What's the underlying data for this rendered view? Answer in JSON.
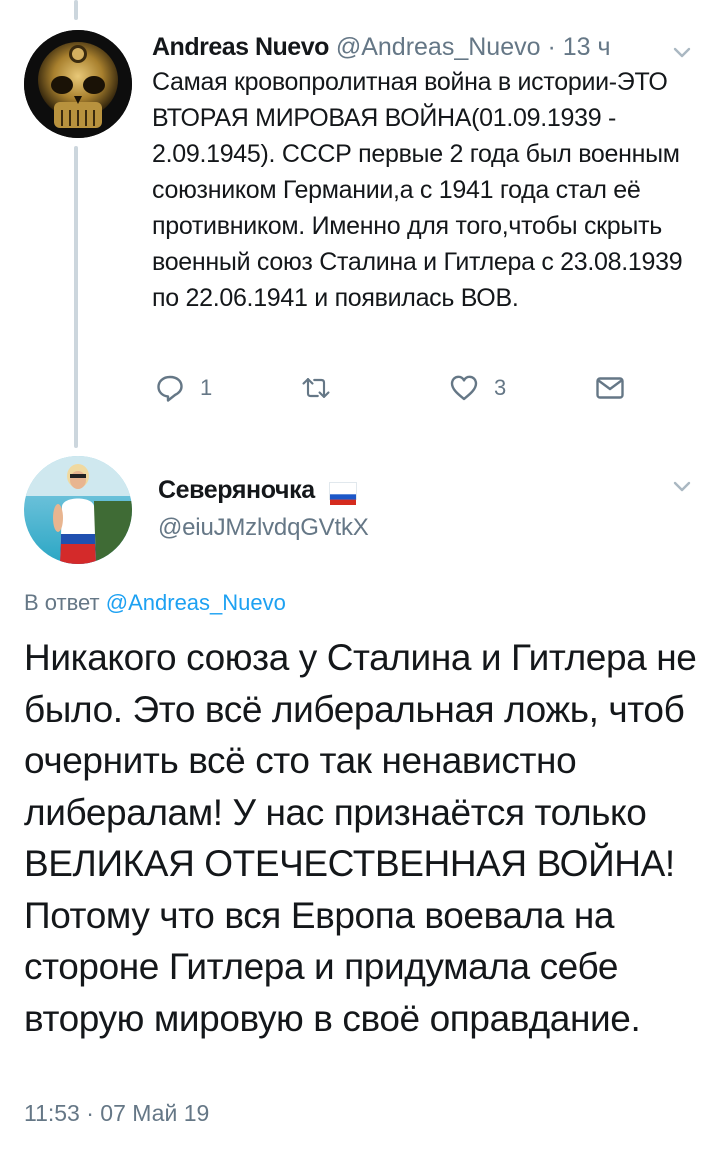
{
  "tweet1": {
    "name": "Andreas Nuevo",
    "handle": "@Andreas_Nuevo",
    "separator": "·",
    "time": "13 ч",
    "text": "Самая кровопролитная война в истории-ЭТО ВТОРАЯ МИРОВАЯ ВОЙНА(01.09.1939 - 2.09.1945). СССР первые 2 года был военным союзником Германии,а с 1941 года стал её противником. Именно для того,чтобы скрыть военный союз Сталина и Гитлера с 23.08.1939 по 22.06.1941 и появилась ВОВ.",
    "replies": "1",
    "retweets": "",
    "likes": "3",
    "icons": [
      "reply-icon",
      "retweet-icon",
      "like-icon",
      "direct-message-icon",
      "chevron-down-icon"
    ]
  },
  "tweet2": {
    "name": "Северяночка",
    "flag": "russian-flag-emoji",
    "handle": "@eiuJMzlvdqGVtkX",
    "reply_prefix": "В ответ",
    "reply_handle": "@Andreas_Nuevo",
    "text": "Никакого союза у Сталина и Гитлера не было. Это всё либеральная ложь, чтоб очернить всё сто так ненавистно либералам! У нас признаётся только ВЕЛИКАЯ ОТЕЧЕСТВЕННАЯ ВОЙНА! Потому что вся Европа воевала на стороне Гитлера и придумала себе вторую мировую в своё оправдание.",
    "timestamp": "11:53 · 07 Май 19"
  },
  "colors": {
    "text": "#14171a",
    "secondary": "#657786",
    "link": "#1da1f2",
    "thread_line": "#ccd6dd"
  }
}
